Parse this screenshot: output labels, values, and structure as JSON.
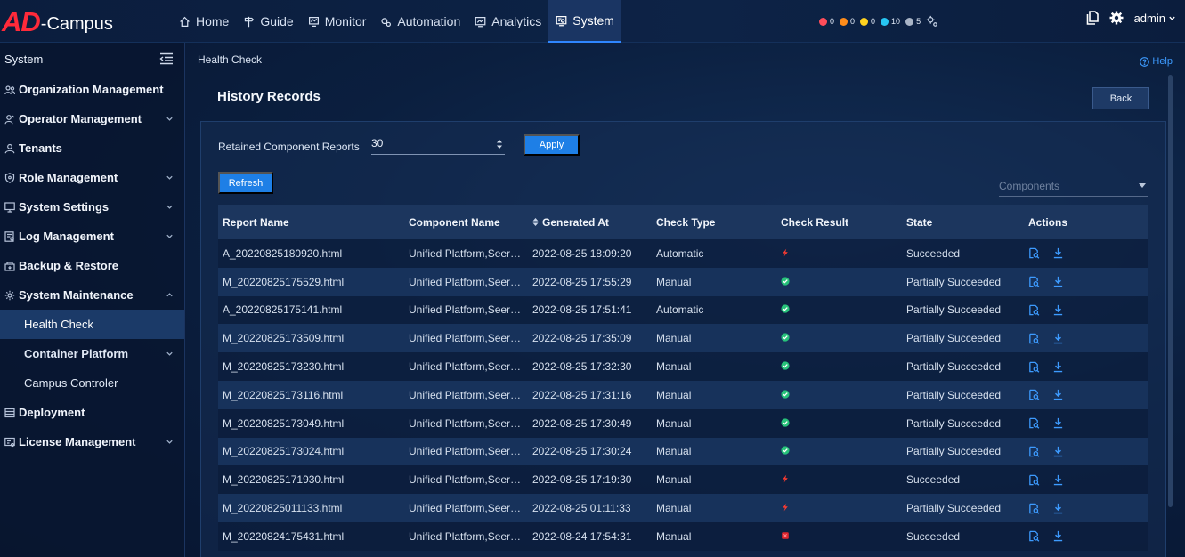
{
  "brand": {
    "logo_ad": "AD",
    "logo_rest": "-Campus"
  },
  "nav": [
    {
      "label": "Home",
      "icon": "home-icon"
    },
    {
      "label": "Guide",
      "icon": "signpost-icon"
    },
    {
      "label": "Monitor",
      "icon": "monitor-icon"
    },
    {
      "label": "Automation",
      "icon": "automation-icon"
    },
    {
      "label": "Analytics",
      "icon": "analytics-icon"
    },
    {
      "label": "System",
      "icon": "system-icon",
      "active": true
    }
  ],
  "alerts": [
    {
      "value": "0",
      "color": "#ff4d5a"
    },
    {
      "value": "0",
      "color": "#ff8c1a"
    },
    {
      "value": "0",
      "color": "#ffd21f"
    },
    {
      "value": "10",
      "color": "#27c6f2"
    },
    {
      "value": "5",
      "color": "#a9b4c6"
    }
  ],
  "user": {
    "name": "admin"
  },
  "sidebar": {
    "title": "System",
    "items": [
      {
        "label": "Organization Management",
        "icon": "org-icon",
        "chevron": false
      },
      {
        "label": "Operator Management",
        "icon": "operator-icon",
        "chevron": true
      },
      {
        "label": "Tenants",
        "icon": "tenant-icon",
        "chevron": false
      },
      {
        "label": "Role Management",
        "icon": "role-icon",
        "chevron": true
      },
      {
        "label": "System Settings",
        "icon": "settings-icon",
        "chevron": true
      },
      {
        "label": "Log Management",
        "icon": "log-icon",
        "chevron": true
      },
      {
        "label": "Backup & Restore",
        "icon": "backup-icon",
        "chevron": false
      },
      {
        "label": "System Maintenance",
        "icon": "maintenance-icon",
        "chevron": "up"
      }
    ],
    "sub_items": [
      {
        "label": "Health Check",
        "active": true
      },
      {
        "label": "Container Platform",
        "bold": true,
        "chevron": true
      },
      {
        "label": "Campus Controler"
      }
    ],
    "bottom_items": [
      {
        "label": "Deployment",
        "icon": "deployment-icon",
        "chevron": false
      },
      {
        "label": "License Management",
        "icon": "license-icon",
        "chevron": true
      }
    ]
  },
  "breadcrumb": "Health Check",
  "help_label": "Help",
  "page_title": "History Records",
  "back_label": "Back",
  "retain": {
    "label": "Retained Component Reports",
    "value": "30",
    "apply_label": "Apply"
  },
  "refresh_label": "Refresh",
  "components_placeholder": "Components",
  "table": {
    "columns": [
      "Report Name",
      "Component Name",
      "Generated At",
      "Check Type",
      "Check Result",
      "State",
      "Actions"
    ],
    "rows": [
      {
        "report": "A_20220825180920.html",
        "component": "Unified Platform,Seer…",
        "generated": "2022-08-25 18:09:20",
        "type": "Automatic",
        "result": "warning",
        "state": "Succeeded"
      },
      {
        "report": "M_20220825175529.html",
        "component": "Unified Platform,Seer…",
        "generated": "2022-08-25 17:55:29",
        "type": "Manual",
        "result": "ok",
        "state": "Partially Succeeded"
      },
      {
        "report": "A_20220825175141.html",
        "component": "Unified Platform,Seer…",
        "generated": "2022-08-25 17:51:41",
        "type": "Automatic",
        "result": "ok",
        "state": "Partially Succeeded"
      },
      {
        "report": "M_20220825173509.html",
        "component": "Unified Platform,Seer…",
        "generated": "2022-08-25 17:35:09",
        "type": "Manual",
        "result": "ok",
        "state": "Partially Succeeded"
      },
      {
        "report": "M_20220825173230.html",
        "component": "Unified Platform,Seer…",
        "generated": "2022-08-25 17:32:30",
        "type": "Manual",
        "result": "ok",
        "state": "Partially Succeeded"
      },
      {
        "report": "M_20220825173116.html",
        "component": "Unified Platform,Seer…",
        "generated": "2022-08-25 17:31:16",
        "type": "Manual",
        "result": "ok",
        "state": "Partially Succeeded"
      },
      {
        "report": "M_20220825173049.html",
        "component": "Unified Platform,Seer…",
        "generated": "2022-08-25 17:30:49",
        "type": "Manual",
        "result": "ok",
        "state": "Partially Succeeded"
      },
      {
        "report": "M_20220825173024.html",
        "component": "Unified Platform,Seer…",
        "generated": "2022-08-25 17:30:24",
        "type": "Manual",
        "result": "ok",
        "state": "Partially Succeeded"
      },
      {
        "report": "M_20220825171930.html",
        "component": "Unified Platform,Seer…",
        "generated": "2022-08-25 17:19:30",
        "type": "Manual",
        "result": "warning",
        "state": "Succeeded"
      },
      {
        "report": "M_20220825011133.html",
        "component": "Unified Platform,Seer…",
        "generated": "2022-08-25 01:11:33",
        "type": "Manual",
        "result": "warning",
        "state": "Partially Succeeded"
      },
      {
        "report": "M_20220824175431.html",
        "component": "Unified Platform,Seer…",
        "generated": "2022-08-24 17:54:31",
        "type": "Manual",
        "result": "error",
        "state": "Succeeded"
      }
    ]
  },
  "colors": {
    "accent": "#1e7fe6",
    "ok": "#27c27a",
    "warning": "#ff3b30",
    "error": "#e0262f",
    "link": "#3d9bff"
  }
}
